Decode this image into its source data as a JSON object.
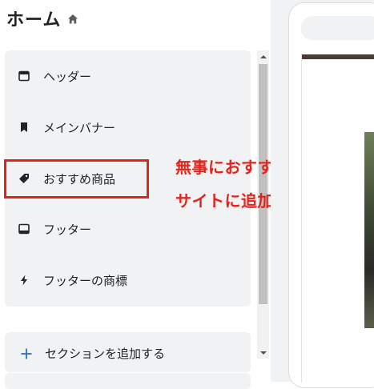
{
  "header": {
    "title": "ホーム",
    "icon": "home-icon"
  },
  "sections": {
    "items": [
      {
        "label": "ヘッダー",
        "icon": "header-icon"
      },
      {
        "label": "メインバナー",
        "icon": "bookmark-icon"
      },
      {
        "label": "おすすめ商品",
        "icon": "tag-icon"
      },
      {
        "label": "フッター",
        "icon": "footer-icon"
      },
      {
        "label": "フッターの商標",
        "icon": "lightning-icon"
      }
    ]
  },
  "add_section": {
    "label": "セクションを追加する",
    "icon": "plus-icon"
  },
  "annotation": {
    "line1": "無事におすすめ商品が",
    "line2": "サイトに追加された。"
  },
  "colors": {
    "annotation": "#e2231a",
    "accent": "#2c6ecb",
    "card_bg": "#f1f2f4"
  }
}
